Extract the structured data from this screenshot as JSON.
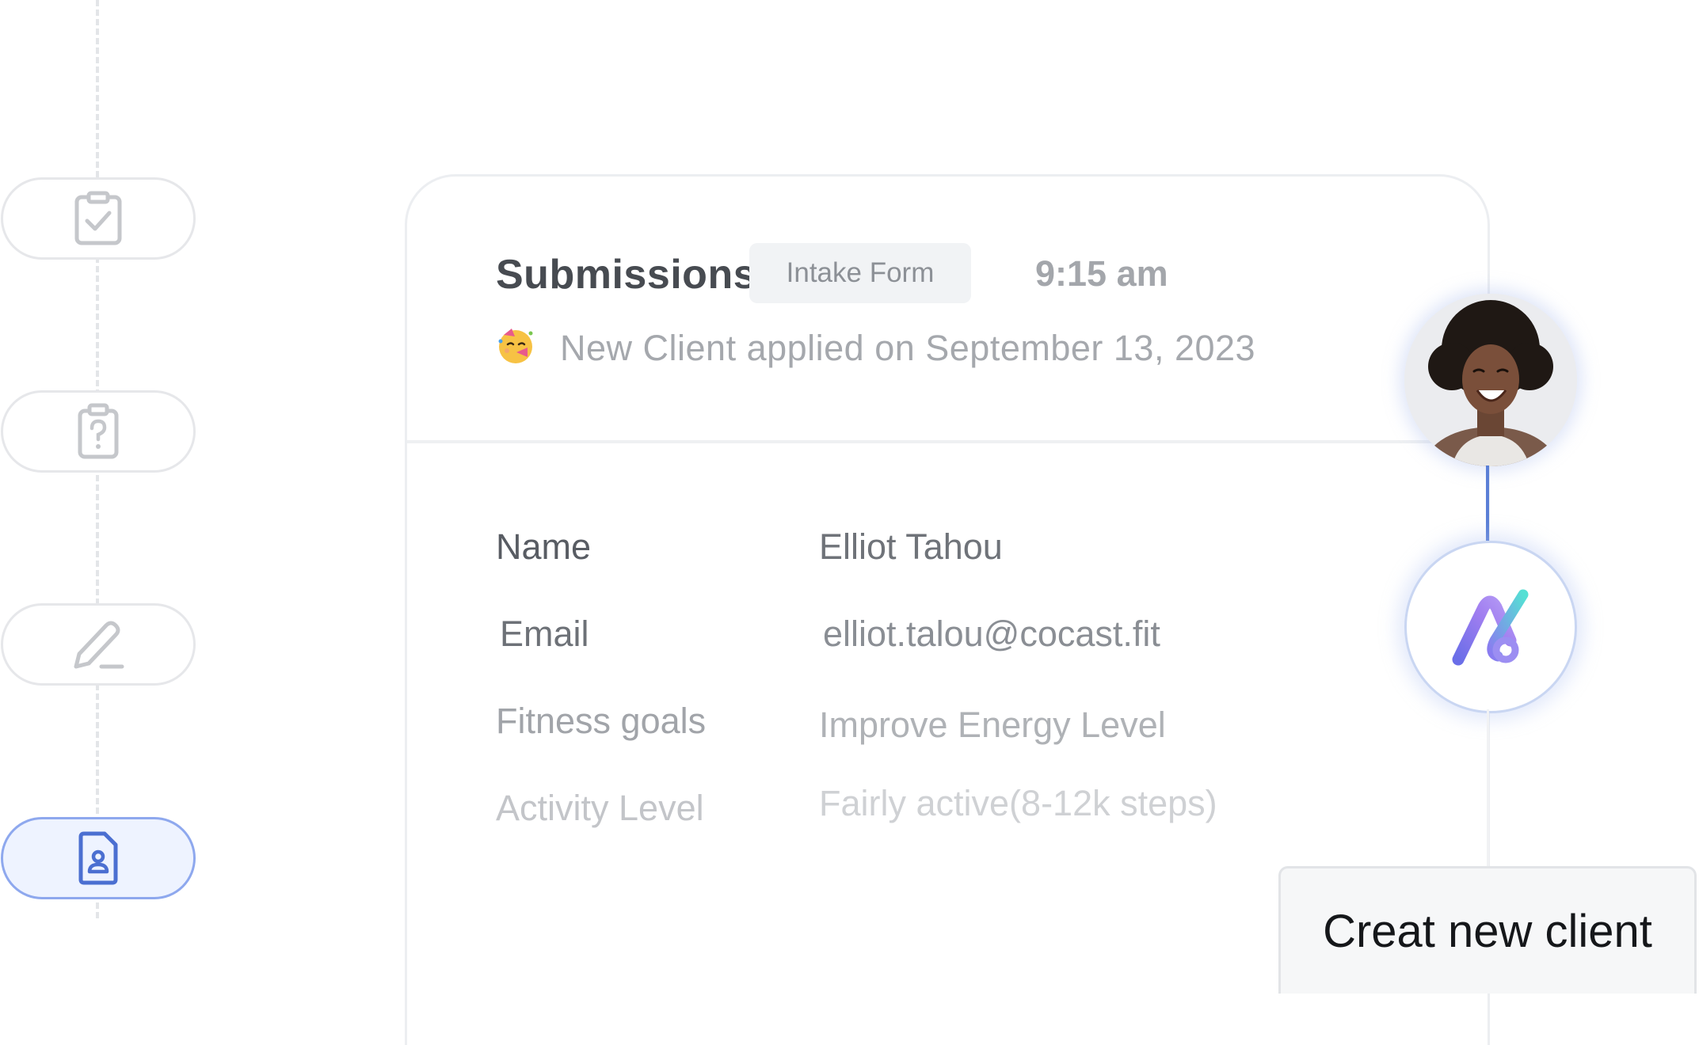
{
  "rail": {
    "steps": [
      {
        "icon": "clipboard-check-icon",
        "state": "inactive"
      },
      {
        "icon": "clipboard-question-icon",
        "state": "inactive"
      },
      {
        "icon": "pencil-icon",
        "state": "inactive"
      },
      {
        "icon": "document-user-icon",
        "state": "active"
      }
    ]
  },
  "card": {
    "title": "Submissions",
    "tag": "Intake Form",
    "time": "9:15 am",
    "emoji_icon": "party-face-icon",
    "subtitle": "New Client applied on September 13, 2023",
    "fields": [
      {
        "label": "Name",
        "value": "Elliot Tahou"
      },
      {
        "label": "Email",
        "value": "elliot.talou@cocast.fit"
      },
      {
        "label": "Fitness goals",
        "value": "Improve Energy Level"
      },
      {
        "label": "Activity Level",
        "value": "Fairly active(8-12k steps)"
      }
    ]
  },
  "connector": {
    "avatar_icon": "client-avatar",
    "logo_icon": "app-logo-icon"
  },
  "create_button": {
    "label": "Creat new client"
  },
  "colors": {
    "accent": "#5b7fd6",
    "active_step_bg": "#eef3ff",
    "active_step_border": "#8ea8ee"
  }
}
